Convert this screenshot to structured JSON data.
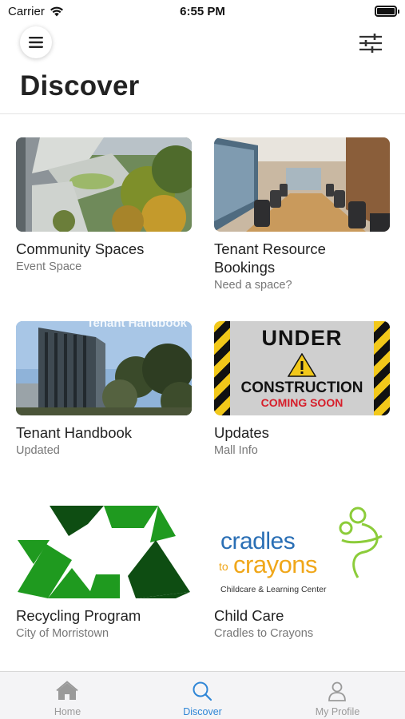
{
  "status_bar": {
    "carrier": "Carrier",
    "time": "6:55 PM",
    "battery_level": 1.0
  },
  "header": {
    "title": "Discover",
    "menu_icon": "hamburger-menu-icon",
    "filter_icon": "sliders-filter-icon"
  },
  "cards": [
    {
      "title": "Community Spaces",
      "subtitle": "Event Space",
      "image": "aerial-campus-photo"
    },
    {
      "title": "Tenant Resource Bookings",
      "subtitle": "Need a space?",
      "image": "conference-room-photo"
    },
    {
      "title": "Tenant Handbook",
      "subtitle": "Updated",
      "image": "office-tower-photo",
      "image_caption": "Tenant Handbook"
    },
    {
      "title": "Updates",
      "subtitle": "Mall Info",
      "image": "under-construction-sign",
      "sign": {
        "line1": "UNDER",
        "line2": "CONSTRUCTION",
        "line3": "COMING SOON"
      }
    },
    {
      "title": "Recycling Program",
      "subtitle": "City of Morristown",
      "image": "recycling-symbol"
    },
    {
      "title": "Child Care",
      "subtitle": "Cradles to Crayons",
      "image": "cradles-to-crayons-logo",
      "logo": {
        "word1": "cradles",
        "word2": "to",
        "word3": "crayons",
        "tagline": "Childcare & Learning Center"
      }
    }
  ],
  "tabs": [
    {
      "label": "Home",
      "icon": "home-icon",
      "active": false
    },
    {
      "label": "Discover",
      "icon": "search-icon",
      "active": true
    },
    {
      "label": "My Profile",
      "icon": "user-icon",
      "active": false
    }
  ],
  "colors": {
    "accent": "#2f86d6",
    "inactive_tab": "#9a9a9a",
    "recycle_green": "#1f9a1f",
    "logo_blue": "#2a6fb5",
    "logo_orange": "#f0a71a"
  }
}
